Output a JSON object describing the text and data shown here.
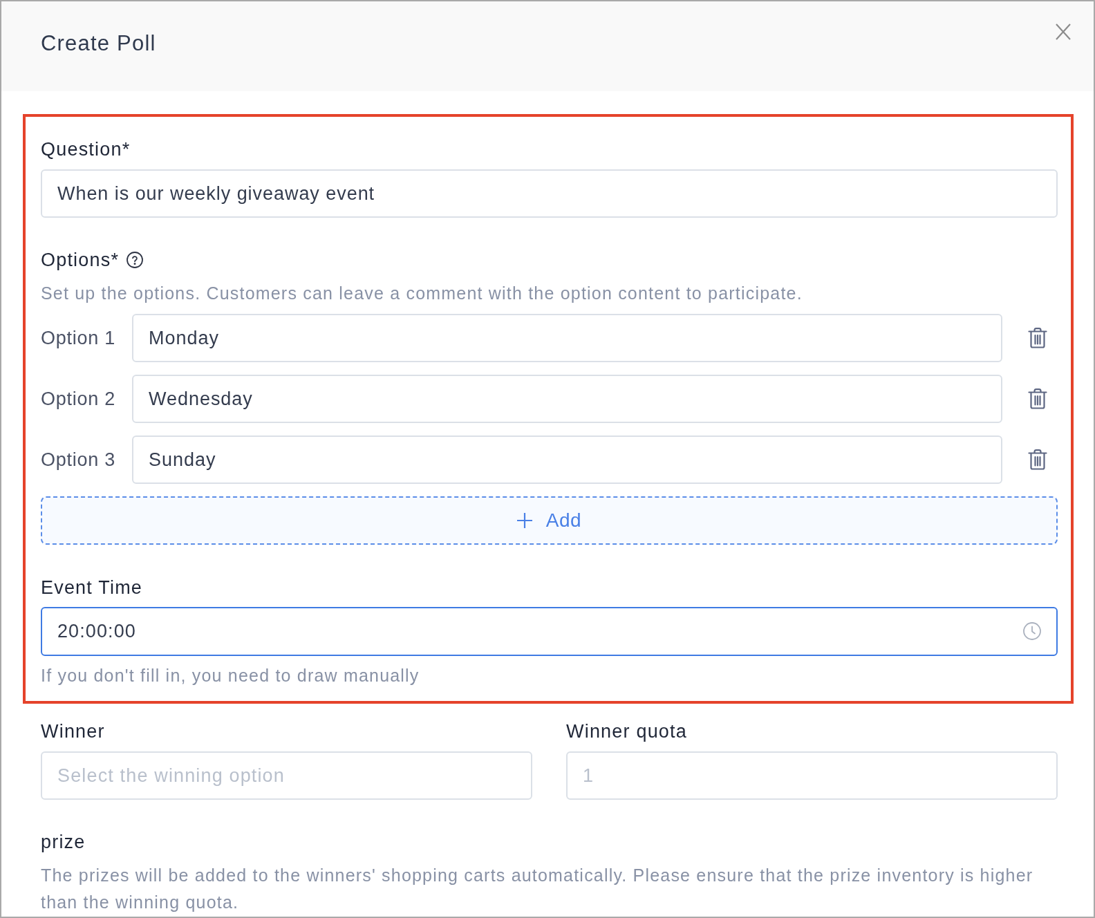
{
  "dialog": {
    "title": "Create Poll"
  },
  "question": {
    "label": "Question*",
    "value": "When is our weekly giveaway event"
  },
  "options": {
    "label": "Options*",
    "description": "Set up the options. Customers can leave a comment with the option content to participate.",
    "items": [
      {
        "label": "Option 1",
        "value": "Monday"
      },
      {
        "label": "Option 2",
        "value": "Wednesday"
      },
      {
        "label": "Option 3",
        "value": "Sunday"
      }
    ],
    "add_button": "Add"
  },
  "event_time": {
    "label": "Event Time",
    "value": "20:00:00",
    "focused": true,
    "hint": "If you don't fill in, you need to draw manually"
  },
  "winner": {
    "label": "Winner",
    "placeholder": "Select the winning option"
  },
  "winner_quota": {
    "label": "Winner quota",
    "placeholder": "1"
  },
  "prize": {
    "label": "prize",
    "description": "The prizes will be added to the winners' shopping carts automatically. Please ensure that the prize inventory is higher than the winning quota."
  }
}
